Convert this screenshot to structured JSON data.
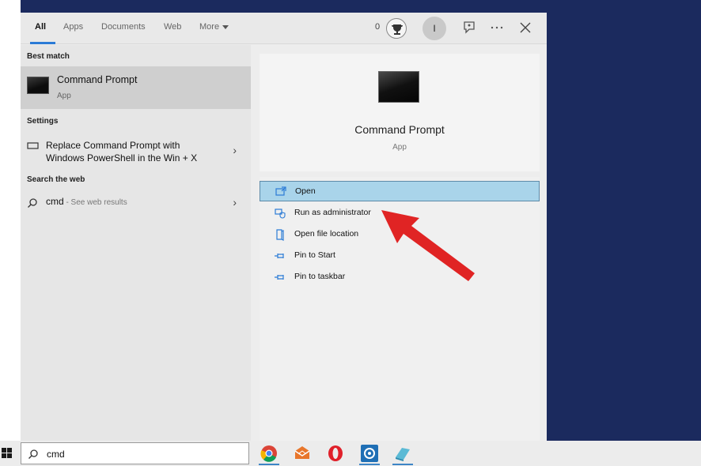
{
  "tabs": [
    {
      "label": "All",
      "active": true
    },
    {
      "label": "Apps"
    },
    {
      "label": "Documents"
    },
    {
      "label": "Web"
    },
    {
      "label": "More"
    }
  ],
  "header": {
    "rewards_count": "0",
    "avatar_initial": "I"
  },
  "results": {
    "best_match_heading": "Best match",
    "best_match": {
      "title": "Command Prompt",
      "subtitle": "App"
    },
    "settings_heading": "Settings",
    "setting_item": {
      "line1": "Replace Command Prompt with",
      "line2": "Windows PowerShell in the Win + X"
    },
    "web_heading": "Search the web",
    "web_item": {
      "query": "cmd",
      "suffix": " - See web results"
    }
  },
  "preview": {
    "title": "Command Prompt",
    "subtitle": "App"
  },
  "actions": [
    {
      "label": "Open",
      "icon": "open-icon",
      "selected": true
    },
    {
      "label": "Run as administrator",
      "icon": "shield-admin-icon"
    },
    {
      "label": "Open file location",
      "icon": "file-location-icon"
    },
    {
      "label": "Pin to Start",
      "icon": "pin-icon"
    },
    {
      "label": "Pin to taskbar",
      "icon": "pin-icon"
    }
  ],
  "taskbar": {
    "search_value": "cmd",
    "apps": [
      "chrome-icon",
      "mail-icon",
      "opera-icon",
      "settings-app-icon",
      "file-manager-icon"
    ]
  },
  "colors": {
    "selection": "#a9d4ea",
    "accent": "#2b7bd6",
    "arrow": "#e02424",
    "desktop": "#1b2a5e"
  }
}
